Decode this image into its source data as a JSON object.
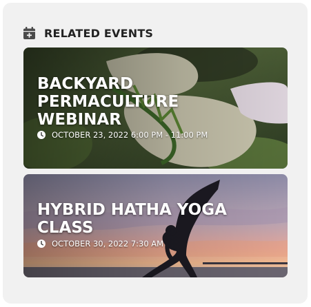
{
  "section": {
    "title": "RELATED EVENTS",
    "icon": "calendar-plus-icon"
  },
  "events": [
    {
      "title_line1": "BACKYARD",
      "title_line2": "PERMACULTURE",
      "title_line3": "WEBINAR",
      "datetime": "OCTOBER 23, 2022 6:00 PM - 11:00 PM",
      "image": "gloved-hands-holding-weeds-photo"
    },
    {
      "title_line1": "HYBRID HATHA YOGA",
      "title_line2": "CLASS",
      "datetime": "OCTOBER 30, 2022 7:30 AM",
      "image": "yoga-pose-sunset-silhouette-photo"
    }
  ],
  "colors": {
    "panel_bg": "#f1f1f1",
    "heading_text": "#222222",
    "card_text": "#ffffff"
  }
}
